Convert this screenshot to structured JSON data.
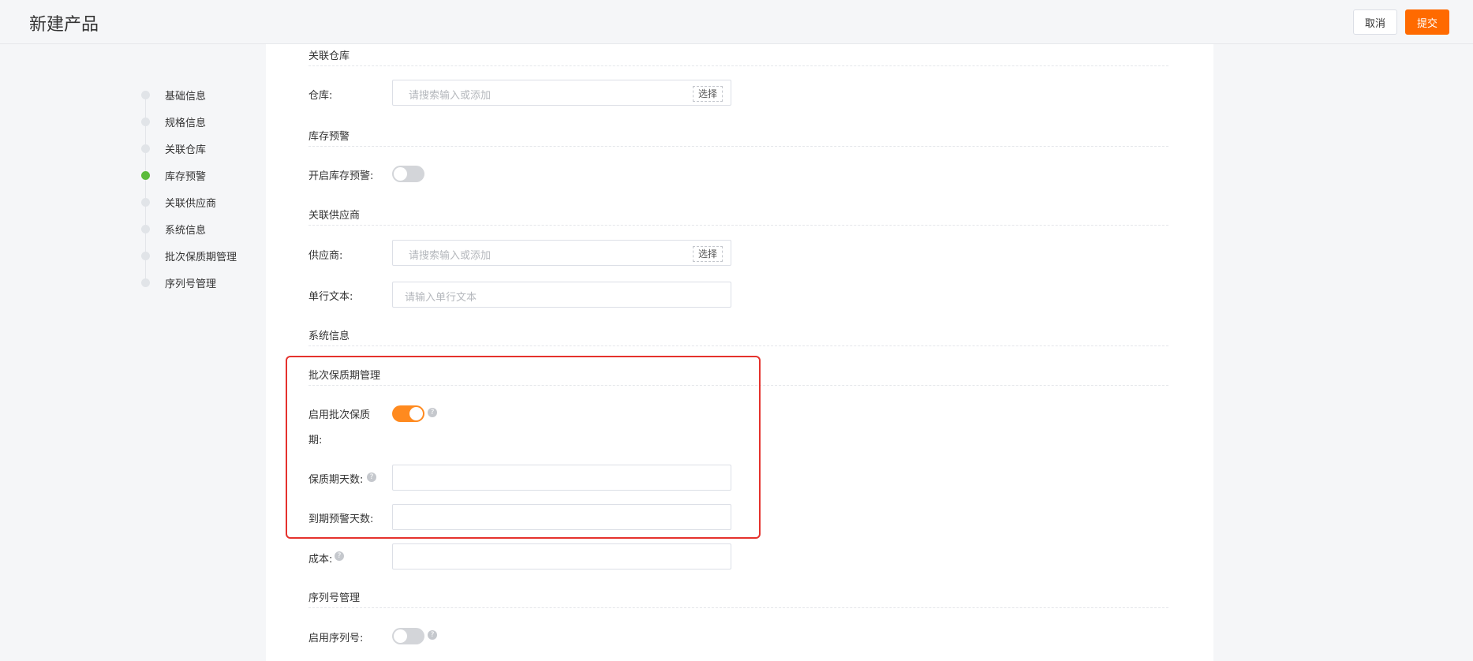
{
  "header": {
    "title": "新建产品",
    "cancel_label": "取消",
    "submit_label": "提交"
  },
  "nav": {
    "items": [
      {
        "label": "基础信息",
        "active": false
      },
      {
        "label": "规格信息",
        "active": false
      },
      {
        "label": "关联仓库",
        "active": false
      },
      {
        "label": "库存预警",
        "active": true
      },
      {
        "label": "关联供应商",
        "active": false
      },
      {
        "label": "系统信息",
        "active": false
      },
      {
        "label": "批次保质期管理",
        "active": false
      },
      {
        "label": "序列号管理",
        "active": false
      }
    ]
  },
  "form": {
    "warehouse_section": "关联仓库",
    "warehouse_label": "仓库:",
    "warehouse_placeholder": "请搜索输入或添加",
    "warehouse_select": "选择",
    "stock_alert_section": "库存预警",
    "stock_alert_label": "开启库存预警:",
    "stock_alert_enabled": false,
    "supplier_section": "关联供应商",
    "supplier_label": "供应商:",
    "supplier_placeholder": "请搜索输入或添加",
    "supplier_select": "选择",
    "single_text_label": "单行文本:",
    "single_text_placeholder": "请输入单行文本",
    "system_section": "系统信息",
    "batch_section": "批次保质期管理",
    "batch_enable_label_line1": "启用批次保质",
    "batch_enable_label_line2": "期:",
    "batch_enabled": true,
    "shelf_life_label": "保质期天数:",
    "expiry_alert_label": "到期预警天数:",
    "cost_label": "成本:",
    "serial_section": "序列号管理",
    "serial_enable_label": "启用序列号:",
    "serial_enabled": false,
    "help_glyph": "?"
  },
  "colors": {
    "accent": "#ff6a00",
    "toggle_on": "#ff8a1f",
    "active_nav_dot": "#5cbb3b",
    "highlight_border": "#e5322d"
  }
}
